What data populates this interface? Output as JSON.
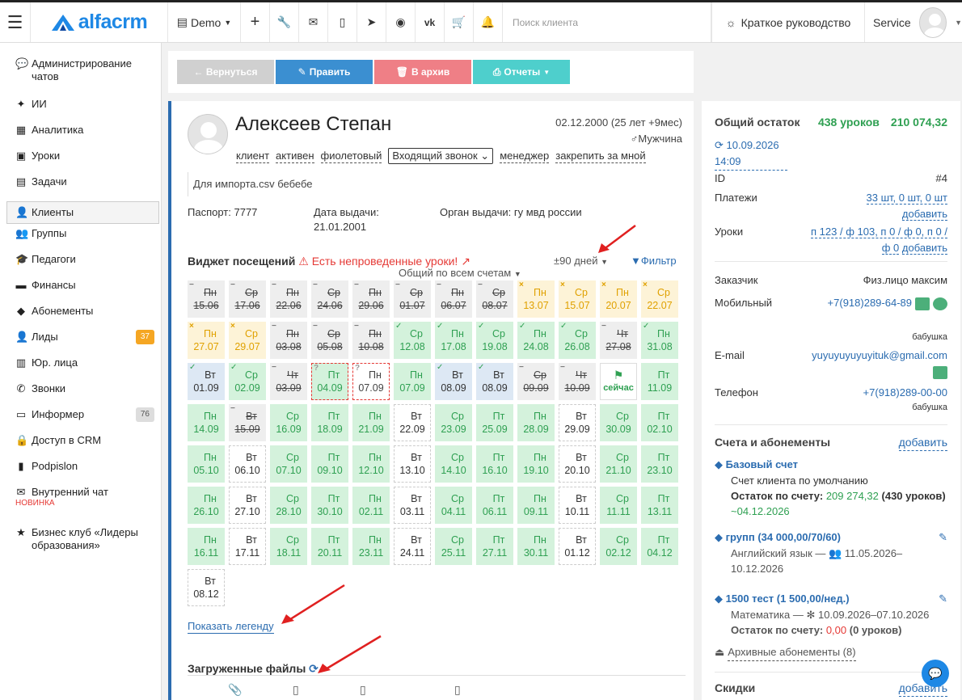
{
  "topbar": {
    "brand": "alfacrm",
    "demo": "Demo",
    "search_placeholder": "Поиск клиента",
    "guide": "Краткое руководство",
    "user": "Service",
    "icons": [
      "plus-icon",
      "wrench-icon",
      "mail-icon",
      "mobile-icon",
      "telegram-icon",
      "whatsapp-icon",
      "vk-icon",
      "cart-icon",
      "bell-icon"
    ]
  },
  "sidebar": {
    "items": [
      {
        "label": "Администрирование чатов",
        "icon": "chat-bubble-icon"
      },
      {
        "label": "ИИ",
        "icon": "sparkle-icon"
      },
      {
        "label": "Аналитика",
        "icon": "map-icon"
      },
      {
        "label": "Уроки",
        "icon": "calendar-icon"
      },
      {
        "label": "Задачи",
        "icon": "clipboard-icon"
      },
      {
        "label": "Клиенты",
        "icon": "user-icon"
      },
      {
        "label": "Группы",
        "icon": "users-icon"
      },
      {
        "label": "Педагоги",
        "icon": "graduation-cap-icon"
      },
      {
        "label": "Финансы",
        "icon": "money-icon"
      },
      {
        "label": "Абонементы",
        "icon": "tag-icon"
      },
      {
        "label": "Лиды",
        "icon": "user-plus-icon",
        "badge": "37"
      },
      {
        "label": "Юр. лица",
        "icon": "briefcase-icon"
      },
      {
        "label": "Звонки",
        "icon": "phone-icon"
      },
      {
        "label": "Информер",
        "icon": "info-icon",
        "badge": "76"
      },
      {
        "label": "Доступ в CRM",
        "icon": "lock-icon"
      },
      {
        "label": "Podpislon",
        "icon": "file-icon"
      },
      {
        "label": "Внутренний чат",
        "icon": "envelope-icon",
        "note": "НОВИНКА"
      },
      {
        "label": "Бизнес клуб «Лидеры образования»",
        "icon": "star-icon"
      }
    ]
  },
  "toolbar": {
    "back": "← Вернуться",
    "edit": "Править",
    "archive": "В архив",
    "reports": "Отчеты"
  },
  "client": {
    "name": "Алексеев Степан",
    "dob": "02.12.2000 (25 лет +9мес)",
    "gender": "Мужчина",
    "tags": [
      "клиент",
      "активен",
      "фиолетовый"
    ],
    "call_select": "Входящий звонок",
    "manager": "менеджер",
    "assign": "закрепить за мной",
    "note": "Для импорта.csv бебебе",
    "passport_label": "Паспорт:",
    "passport": "7777",
    "issue_date_label": "Дата выдачи:",
    "issue_date": "21.01.2001",
    "issuer_label": "Орган выдачи:",
    "issuer": "гу мвд россии"
  },
  "widget": {
    "title": "Виджет посещений",
    "warning": "Есть непроведенные уроки!",
    "period": "±90 дней",
    "filter": "Фильтр",
    "account_select": "Общий по всем счетам",
    "legend": "Показать легенду",
    "cells": [
      {
        "d": "Пн",
        "n": "15.06",
        "c": "grey",
        "s": "−"
      },
      {
        "d": "Ср",
        "n": "17.06",
        "c": "grey",
        "s": "−"
      },
      {
        "d": "Пн",
        "n": "22.06",
        "c": "grey",
        "s": "−"
      },
      {
        "d": "Ср",
        "n": "24.06",
        "c": "grey",
        "s": "−"
      },
      {
        "d": "Пн",
        "n": "29.06",
        "c": "grey",
        "s": "−"
      },
      {
        "d": "Ср",
        "n": "01.07",
        "c": "grey",
        "s": "−"
      },
      {
        "d": "Пн",
        "n": "06.07",
        "c": "grey",
        "s": "−"
      },
      {
        "d": "Ср",
        "n": "08.07",
        "c": "grey",
        "s": "−"
      },
      {
        "d": "Пн",
        "n": "13.07",
        "c": "yel",
        "s": "×"
      },
      {
        "d": "Ср",
        "n": "15.07",
        "c": "yel",
        "s": "×"
      },
      {
        "d": "Пн",
        "n": "20.07",
        "c": "yel",
        "s": "×"
      },
      {
        "d": "Ср",
        "n": "22.07",
        "c": "yel",
        "s": "×"
      },
      {
        "d": "Пн",
        "n": "27.07",
        "c": "yel",
        "s": "×"
      },
      {
        "d": "Ср",
        "n": "29.07",
        "c": "yel",
        "s": "×"
      },
      {
        "d": "Пн",
        "n": "03.08",
        "c": "grey",
        "s": "−"
      },
      {
        "d": "Ср",
        "n": "05.08",
        "c": "grey",
        "s": "−"
      },
      {
        "d": "Пн",
        "n": "10.08",
        "c": "grey",
        "s": "−"
      },
      {
        "d": "Ср",
        "n": "12.08",
        "c": "grn",
        "s": "✓"
      },
      {
        "d": "Пн",
        "n": "17.08",
        "c": "grn",
        "s": "✓"
      },
      {
        "d": "Ср",
        "n": "19.08",
        "c": "grn",
        "s": "✓"
      },
      {
        "d": "Пн",
        "n": "24.08",
        "c": "grn",
        "s": "✓"
      },
      {
        "d": "Ср",
        "n": "26.08",
        "c": "grn",
        "s": "✓"
      },
      {
        "d": "Чт",
        "n": "27.08",
        "c": "grey",
        "s": "−"
      },
      {
        "d": "Пн",
        "n": "31.08",
        "c": "grn",
        "s": "✓"
      },
      {
        "d": "Вт",
        "n": "01.09",
        "c": "blu",
        "s": "✓"
      },
      {
        "d": "Ср",
        "n": "02.09",
        "c": "grn",
        "s": "✓"
      },
      {
        "d": "Чт",
        "n": "03.09",
        "c": "grey",
        "s": "−"
      },
      {
        "d": "Пт",
        "n": "04.09",
        "c": "red",
        "s": "?"
      },
      {
        "d": "Пн",
        "n": "07.09",
        "c": "redw",
        "s": "?"
      },
      {
        "d": "Пн",
        "n": "07.09",
        "c": "grn",
        "s": ""
      },
      {
        "d": "Вт",
        "n": "08.09",
        "c": "blu",
        "s": "✓"
      },
      {
        "d": "Вт",
        "n": "08.09",
        "c": "blu",
        "s": "✓"
      },
      {
        "d": "Ср",
        "n": "09.09",
        "c": "grey",
        "s": "−"
      },
      {
        "d": "Чт",
        "n": "10.09",
        "c": "grey",
        "s": "−"
      },
      {
        "d": "сейчас",
        "n": "",
        "c": "now",
        "s": ""
      },
      {
        "d": "Пт",
        "n": "11.09",
        "c": "grn",
        "s": ""
      },
      {
        "d": "Пн",
        "n": "14.09",
        "c": "grn",
        "s": ""
      },
      {
        "d": "Вт",
        "n": "15.09",
        "c": "grey",
        "s": "−"
      },
      {
        "d": "Ср",
        "n": "16.09",
        "c": "grn",
        "s": ""
      },
      {
        "d": "Пт",
        "n": "18.09",
        "c": "grn",
        "s": ""
      },
      {
        "d": "Пн",
        "n": "21.09",
        "c": "grn",
        "s": ""
      },
      {
        "d": "Вт",
        "n": "22.09",
        "c": "wht",
        "s": ""
      },
      {
        "d": "Ср",
        "n": "23.09",
        "c": "grn",
        "s": ""
      },
      {
        "d": "Пт",
        "n": "25.09",
        "c": "grn",
        "s": ""
      },
      {
        "d": "Пн",
        "n": "28.09",
        "c": "grn",
        "s": ""
      },
      {
        "d": "Вт",
        "n": "29.09",
        "c": "wht",
        "s": ""
      },
      {
        "d": "Ср",
        "n": "30.09",
        "c": "grn",
        "s": ""
      },
      {
        "d": "Пт",
        "n": "02.10",
        "c": "grn",
        "s": ""
      },
      {
        "d": "Пн",
        "n": "05.10",
        "c": "grn",
        "s": ""
      },
      {
        "d": "Вт",
        "n": "06.10",
        "c": "wht",
        "s": ""
      },
      {
        "d": "Ср",
        "n": "07.10",
        "c": "grn",
        "s": ""
      },
      {
        "d": "Пт",
        "n": "09.10",
        "c": "grn",
        "s": ""
      },
      {
        "d": "Пн",
        "n": "12.10",
        "c": "grn",
        "s": ""
      },
      {
        "d": "Вт",
        "n": "13.10",
        "c": "wht",
        "s": ""
      },
      {
        "d": "Ср",
        "n": "14.10",
        "c": "grn",
        "s": ""
      },
      {
        "d": "Пт",
        "n": "16.10",
        "c": "grn",
        "s": ""
      },
      {
        "d": "Пн",
        "n": "19.10",
        "c": "grn",
        "s": ""
      },
      {
        "d": "Вт",
        "n": "20.10",
        "c": "wht",
        "s": ""
      },
      {
        "d": "Ср",
        "n": "21.10",
        "c": "grn",
        "s": ""
      },
      {
        "d": "Пт",
        "n": "23.10",
        "c": "grn",
        "s": ""
      },
      {
        "d": "Пн",
        "n": "26.10",
        "c": "grn",
        "s": ""
      },
      {
        "d": "Вт",
        "n": "27.10",
        "c": "wht",
        "s": ""
      },
      {
        "d": "Ср",
        "n": "28.10",
        "c": "grn",
        "s": ""
      },
      {
        "d": "Пт",
        "n": "30.10",
        "c": "grn",
        "s": ""
      },
      {
        "d": "Пн",
        "n": "02.11",
        "c": "grn",
        "s": ""
      },
      {
        "d": "Вт",
        "n": "03.11",
        "c": "wht",
        "s": ""
      },
      {
        "d": "Ср",
        "n": "04.11",
        "c": "grn",
        "s": ""
      },
      {
        "d": "Пт",
        "n": "06.11",
        "c": "grn",
        "s": ""
      },
      {
        "d": "Пн",
        "n": "09.11",
        "c": "grn",
        "s": ""
      },
      {
        "d": "Вт",
        "n": "10.11",
        "c": "wht",
        "s": ""
      },
      {
        "d": "Ср",
        "n": "11.11",
        "c": "grn",
        "s": ""
      },
      {
        "d": "Пт",
        "n": "13.11",
        "c": "grn",
        "s": ""
      },
      {
        "d": "Пн",
        "n": "16.11",
        "c": "grn",
        "s": ""
      },
      {
        "d": "Вт",
        "n": "17.11",
        "c": "wht",
        "s": ""
      },
      {
        "d": "Ср",
        "n": "18.11",
        "c": "grn",
        "s": ""
      },
      {
        "d": "Пт",
        "n": "20.11",
        "c": "grn",
        "s": ""
      },
      {
        "d": "Пн",
        "n": "23.11",
        "c": "grn",
        "s": ""
      },
      {
        "d": "Вт",
        "n": "24.11",
        "c": "wht",
        "s": ""
      },
      {
        "d": "Ср",
        "n": "25.11",
        "c": "grn",
        "s": ""
      },
      {
        "d": "Пт",
        "n": "27.11",
        "c": "grn",
        "s": ""
      },
      {
        "d": "Пн",
        "n": "30.11",
        "c": "grn",
        "s": ""
      },
      {
        "d": "Вт",
        "n": "01.12",
        "c": "wht",
        "s": ""
      },
      {
        "d": "Ср",
        "n": "02.12",
        "c": "grn",
        "s": ""
      },
      {
        "d": "Пт",
        "n": "04.12",
        "c": "grn",
        "s": ""
      },
      {
        "d": "Вт",
        "n": "08.12",
        "c": "wht",
        "s": ""
      }
    ]
  },
  "files": {
    "title": "Загруженные файлы"
  },
  "right": {
    "balance_label": "Общий остаток",
    "balance_lessons": "438 уроков",
    "balance_sum": "210 074,32",
    "sync_date": "10.09.2026 14:09",
    "id_label": "ID",
    "id": "#4",
    "payments_label": "Платежи",
    "payments": "33 шт, 0 шт, 0 шт",
    "add": "добавить",
    "lessons_label": "Уроки",
    "lessons": "п 123 / ф 103, п 0 / ф 0, п 0 / ф 0",
    "customer_label": "Заказчик",
    "customer": "Физ.лицо максим",
    "mobile_label": "Мобильный",
    "mobile": "+7(918)289-64-89",
    "mobile_note": "бабушка",
    "email_label": "E-mail",
    "email": "yuyuyuyuyuyituk@gmail.com",
    "phone_label": "Телефон",
    "phone": "+7(918)289-00-00",
    "phone_note": "бабушка",
    "accounts_title": "Счета и абонементы",
    "acc1_title": "Базовый счет",
    "acc1_desc": "Счет клиента по умолчанию",
    "acc1_bal_label": "Остаток по счету:",
    "acc1_bal": "209 274,32",
    "acc1_bal2": "(430 уроков)",
    "acc1_until": "~04.12.2026",
    "acc2_title": "групп (34 000,00/70/60)",
    "acc2_desc": "Английский язык —",
    "acc2_dates": "11.05.2026–10.12.2026",
    "acc3_title": "1500 тест (1 500,00/нед.)",
    "acc3_desc": "Математика —",
    "acc3_dates": "10.09.2026–07.10.2026",
    "acc3_bal_label": "Остаток по счету:",
    "acc3_bal": "0,00",
    "acc3_bal2": "(0 уроков)",
    "archived": "Архивные абонементы (8)",
    "discounts": "Скидки"
  }
}
